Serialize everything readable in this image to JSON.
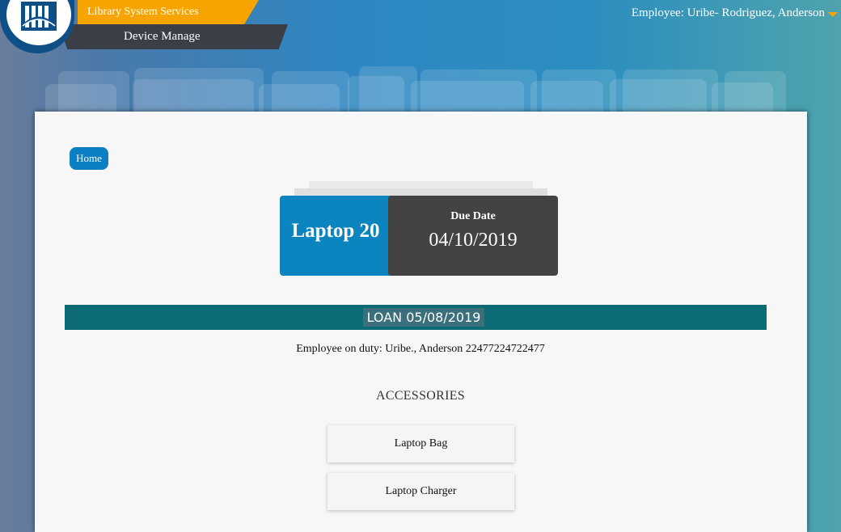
{
  "header": {
    "system_label": "Library System Services",
    "app_label": "Device Manage",
    "employee": "Employee: Uribe- Rodriguez, Anderson"
  },
  "colors": {
    "accent_orange": "#f7a400",
    "dark_tab": "#3a3f47",
    "device_blue": "#0c84c0",
    "due_dark": "#434343",
    "loan_teal": "#0d6b76"
  },
  "breadcrumb": {
    "home": "Home"
  },
  "device": {
    "name": "Laptop 20",
    "due_label": "Due Date",
    "due_value": "04/10/2019"
  },
  "loan": {
    "label": "LOAN 05/08/2019",
    "duty_text": "Employee on duty: Uribe., Anderson 22477224722477"
  },
  "accessories": {
    "title": "ACCESSORIES",
    "items": [
      "Laptop Bag",
      "Laptop Charger"
    ]
  },
  "icons": {
    "logo": "library-logo-icon",
    "dropdown": "caret-down-icon"
  }
}
